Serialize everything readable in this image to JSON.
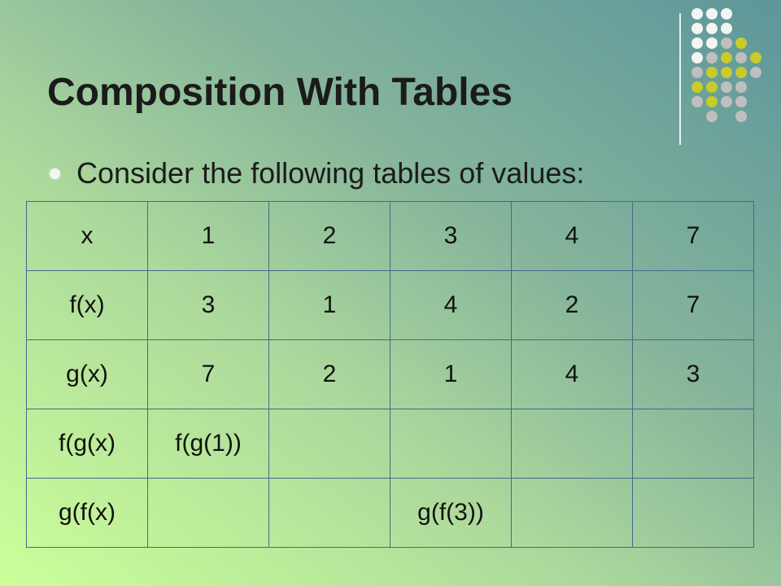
{
  "slide": {
    "title": "Composition With Tables",
    "bullet": "Consider the following tables of values:"
  },
  "table": {
    "rows": [
      [
        "x",
        "1",
        "2",
        "3",
        "4",
        "7"
      ],
      [
        "f(x)",
        "3",
        "1",
        "4",
        "2",
        "7"
      ],
      [
        "g(x)",
        "7",
        "2",
        "1",
        "4",
        "3"
      ],
      [
        "f(g(x)",
        "f(g(1))",
        "",
        "",
        "",
        ""
      ],
      [
        "g(f(x)",
        "",
        "",
        "g(f(3))",
        "",
        ""
      ]
    ]
  },
  "colors": {
    "dot_white": "#f4f4f4",
    "dot_gray": "#bfbfbf",
    "dot_olive": "#c8cb2a",
    "table_border": "#44698f"
  }
}
